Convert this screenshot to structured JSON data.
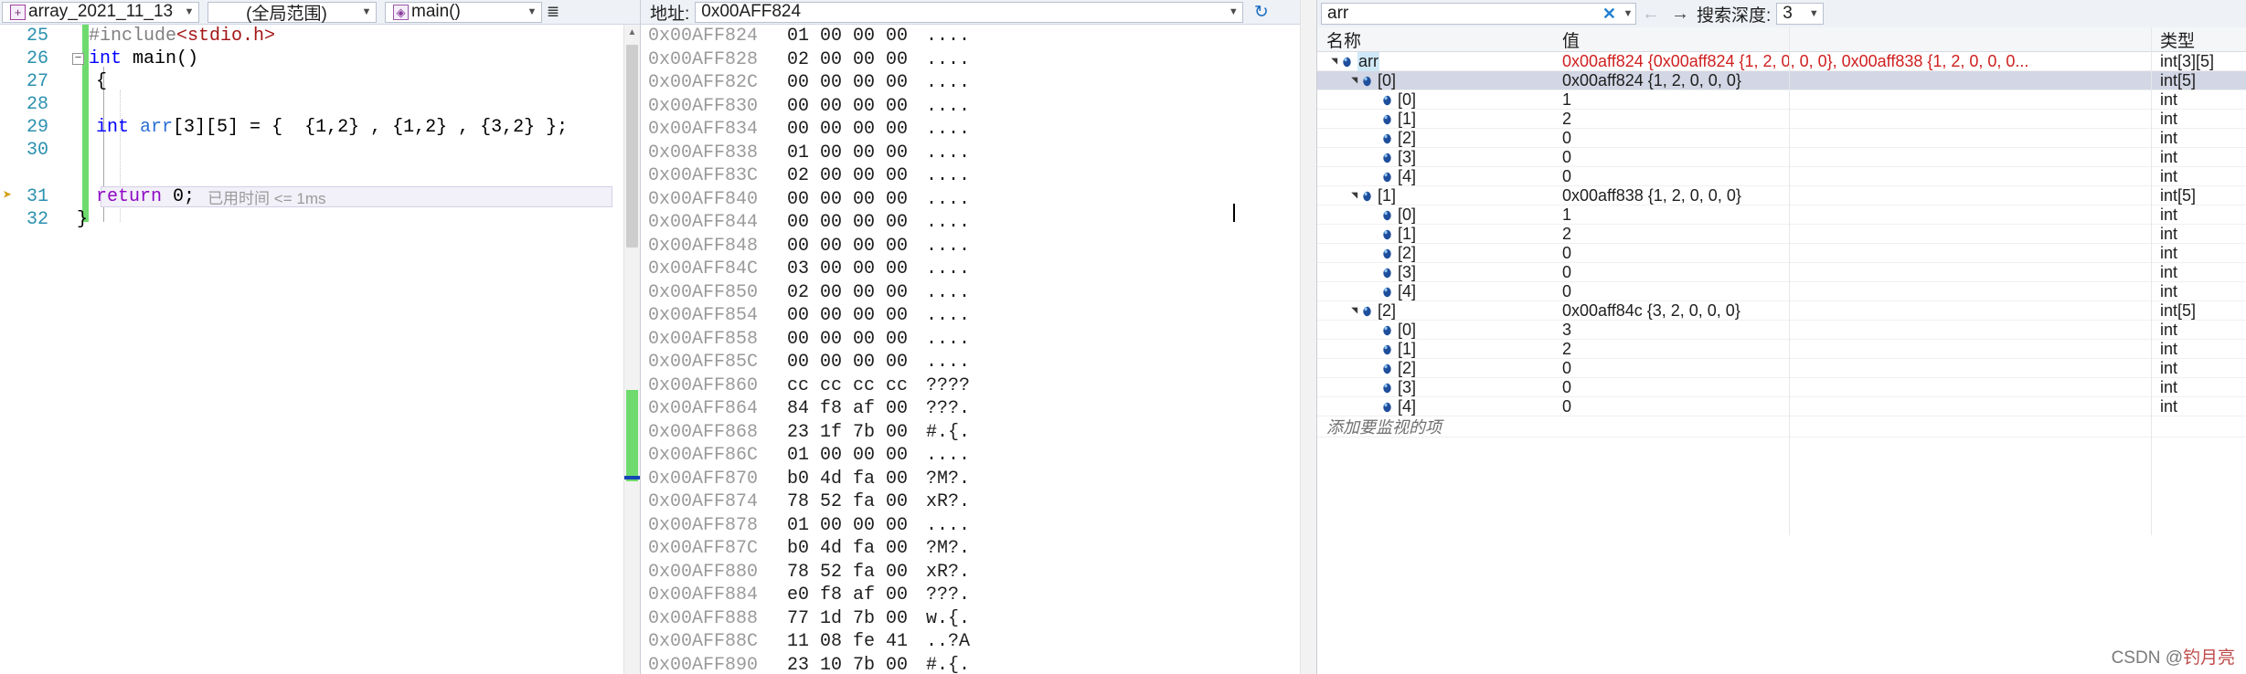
{
  "editor": {
    "project_combo": "array_2021_11_13",
    "scope_combo": "(全局范围)",
    "function_combo": "main()",
    "icons": {
      "project": "project-icon",
      "function": "function-icon",
      "collapse": "collapse-all-icon"
    },
    "lines": [
      {
        "num": "25",
        "indent": 0,
        "text": "#include<stdio.h>"
      },
      {
        "num": "26",
        "indent": 0,
        "text": "int main()"
      },
      {
        "num": "27",
        "indent": 0,
        "text": "{"
      },
      {
        "num": "28",
        "indent": 0,
        "text": ""
      },
      {
        "num": "29",
        "indent": 0,
        "text": "    int arr[3][5] = {  {1,2} , {1,2} , {3,2} };"
      },
      {
        "num": "30",
        "indent": 0,
        "text": ""
      },
      {
        "num": "31",
        "indent": 0,
        "text": "    return 0;"
      },
      {
        "num": "32",
        "indent": 0,
        "text": "}"
      }
    ],
    "time_hint": "已用时间 <= 1ms"
  },
  "memory": {
    "address_label": "地址:",
    "address_value": "0x00AFF824",
    "refresh_icon": "refresh-icon",
    "rows": [
      {
        "addr": "0x00AFF824",
        "hex": "01 00 00 00",
        "ascii": "...."
      },
      {
        "addr": "0x00AFF828",
        "hex": "02 00 00 00",
        "ascii": "...."
      },
      {
        "addr": "0x00AFF82C",
        "hex": "00 00 00 00",
        "ascii": "...."
      },
      {
        "addr": "0x00AFF830",
        "hex": "00 00 00 00",
        "ascii": "...."
      },
      {
        "addr": "0x00AFF834",
        "hex": "00 00 00 00",
        "ascii": "...."
      },
      {
        "addr": "0x00AFF838",
        "hex": "01 00 00 00",
        "ascii": "...."
      },
      {
        "addr": "0x00AFF83C",
        "hex": "02 00 00 00",
        "ascii": "...."
      },
      {
        "addr": "0x00AFF840",
        "hex": "00 00 00 00",
        "ascii": "...."
      },
      {
        "addr": "0x00AFF844",
        "hex": "00 00 00 00",
        "ascii": "...."
      },
      {
        "addr": "0x00AFF848",
        "hex": "00 00 00 00",
        "ascii": "...."
      },
      {
        "addr": "0x00AFF84C",
        "hex": "03 00 00 00",
        "ascii": "...."
      },
      {
        "addr": "0x00AFF850",
        "hex": "02 00 00 00",
        "ascii": "...."
      },
      {
        "addr": "0x00AFF854",
        "hex": "00 00 00 00",
        "ascii": "...."
      },
      {
        "addr": "0x00AFF858",
        "hex": "00 00 00 00",
        "ascii": "...."
      },
      {
        "addr": "0x00AFF85C",
        "hex": "00 00 00 00",
        "ascii": "...."
      },
      {
        "addr": "0x00AFF860",
        "hex": "cc cc cc cc",
        "ascii": "????"
      },
      {
        "addr": "0x00AFF864",
        "hex": "84 f8 af 00",
        "ascii": "???."
      },
      {
        "addr": "0x00AFF868",
        "hex": "23 1f 7b 00",
        "ascii": "#.{."
      },
      {
        "addr": "0x00AFF86C",
        "hex": "01 00 00 00",
        "ascii": "...."
      },
      {
        "addr": "0x00AFF870",
        "hex": "b0 4d fa 00",
        "ascii": "?M?."
      },
      {
        "addr": "0x00AFF874",
        "hex": "78 52 fa 00",
        "ascii": "xR?."
      },
      {
        "addr": "0x00AFF878",
        "hex": "01 00 00 00",
        "ascii": "...."
      },
      {
        "addr": "0x00AFF87C",
        "hex": "b0 4d fa 00",
        "ascii": "?M?."
      },
      {
        "addr": "0x00AFF880",
        "hex": "78 52 fa 00",
        "ascii": "xR?."
      },
      {
        "addr": "0x00AFF884",
        "hex": "e0 f8 af 00",
        "ascii": "???."
      },
      {
        "addr": "0x00AFF888",
        "hex": "77 1d 7b 00",
        "ascii": "w.{."
      },
      {
        "addr": "0x00AFF88C",
        "hex": "11 08 fe 41",
        "ascii": "..?A"
      },
      {
        "addr": "0x00AFF890",
        "hex": "23 10 7b 00",
        "ascii": "#.{."
      }
    ]
  },
  "watch": {
    "search_value": "arr",
    "clear_icon": "clear-icon",
    "back_icon": "back-arrow-icon",
    "forward_icon": "forward-arrow-icon",
    "depth_label": "搜索深度:",
    "depth_value": "3",
    "columns": [
      "名称",
      "值",
      "类型"
    ],
    "add_item_text": "添加要监视的项",
    "rows": [
      {
        "depth": 0,
        "expander": "expanded",
        "name": "arr",
        "value": "0x00aff824 {0x00aff824 {1, 2, 0, 0, 0}, 0x00aff838 {1, 2, 0, 0, 0...",
        "type": "int[3][5]",
        "value_red": true,
        "selected_name": true
      },
      {
        "depth": 1,
        "expander": "expanded",
        "name": "[0]",
        "value": "0x00aff824 {1, 2, 0, 0, 0}",
        "type": "int[5]",
        "selected": true
      },
      {
        "depth": 2,
        "expander": "none",
        "name": "[0]",
        "value": "1",
        "type": "int"
      },
      {
        "depth": 2,
        "expander": "none",
        "name": "[1]",
        "value": "2",
        "type": "int"
      },
      {
        "depth": 2,
        "expander": "none",
        "name": "[2]",
        "value": "0",
        "type": "int"
      },
      {
        "depth": 2,
        "expander": "none",
        "name": "[3]",
        "value": "0",
        "type": "int"
      },
      {
        "depth": 2,
        "expander": "none",
        "name": "[4]",
        "value": "0",
        "type": "int"
      },
      {
        "depth": 1,
        "expander": "expanded",
        "name": "[1]",
        "value": "0x00aff838 {1, 2, 0, 0, 0}",
        "type": "int[5]"
      },
      {
        "depth": 2,
        "expander": "none",
        "name": "[0]",
        "value": "1",
        "type": "int"
      },
      {
        "depth": 2,
        "expander": "none",
        "name": "[1]",
        "value": "2",
        "type": "int"
      },
      {
        "depth": 2,
        "expander": "none",
        "name": "[2]",
        "value": "0",
        "type": "int"
      },
      {
        "depth": 2,
        "expander": "none",
        "name": "[3]",
        "value": "0",
        "type": "int"
      },
      {
        "depth": 2,
        "expander": "none",
        "name": "[4]",
        "value": "0",
        "type": "int"
      },
      {
        "depth": 1,
        "expander": "expanded",
        "name": "[2]",
        "value": "0x00aff84c {3, 2, 0, 0, 0}",
        "type": "int[5]"
      },
      {
        "depth": 2,
        "expander": "none",
        "name": "[0]",
        "value": "3",
        "type": "int"
      },
      {
        "depth": 2,
        "expander": "none",
        "name": "[1]",
        "value": "2",
        "type": "int"
      },
      {
        "depth": 2,
        "expander": "none",
        "name": "[2]",
        "value": "0",
        "type": "int"
      },
      {
        "depth": 2,
        "expander": "none",
        "name": "[3]",
        "value": "0",
        "type": "int"
      },
      {
        "depth": 2,
        "expander": "none",
        "name": "[4]",
        "value": "0",
        "type": "int"
      }
    ]
  },
  "watermark": {
    "prefix": "CSDN @",
    "author": "钓月亮"
  },
  "colors": {
    "accent": "#1f7fd0",
    "value_red": "#d02020",
    "linenum": "#2b91af",
    "changebar": "#6fdb6f"
  }
}
